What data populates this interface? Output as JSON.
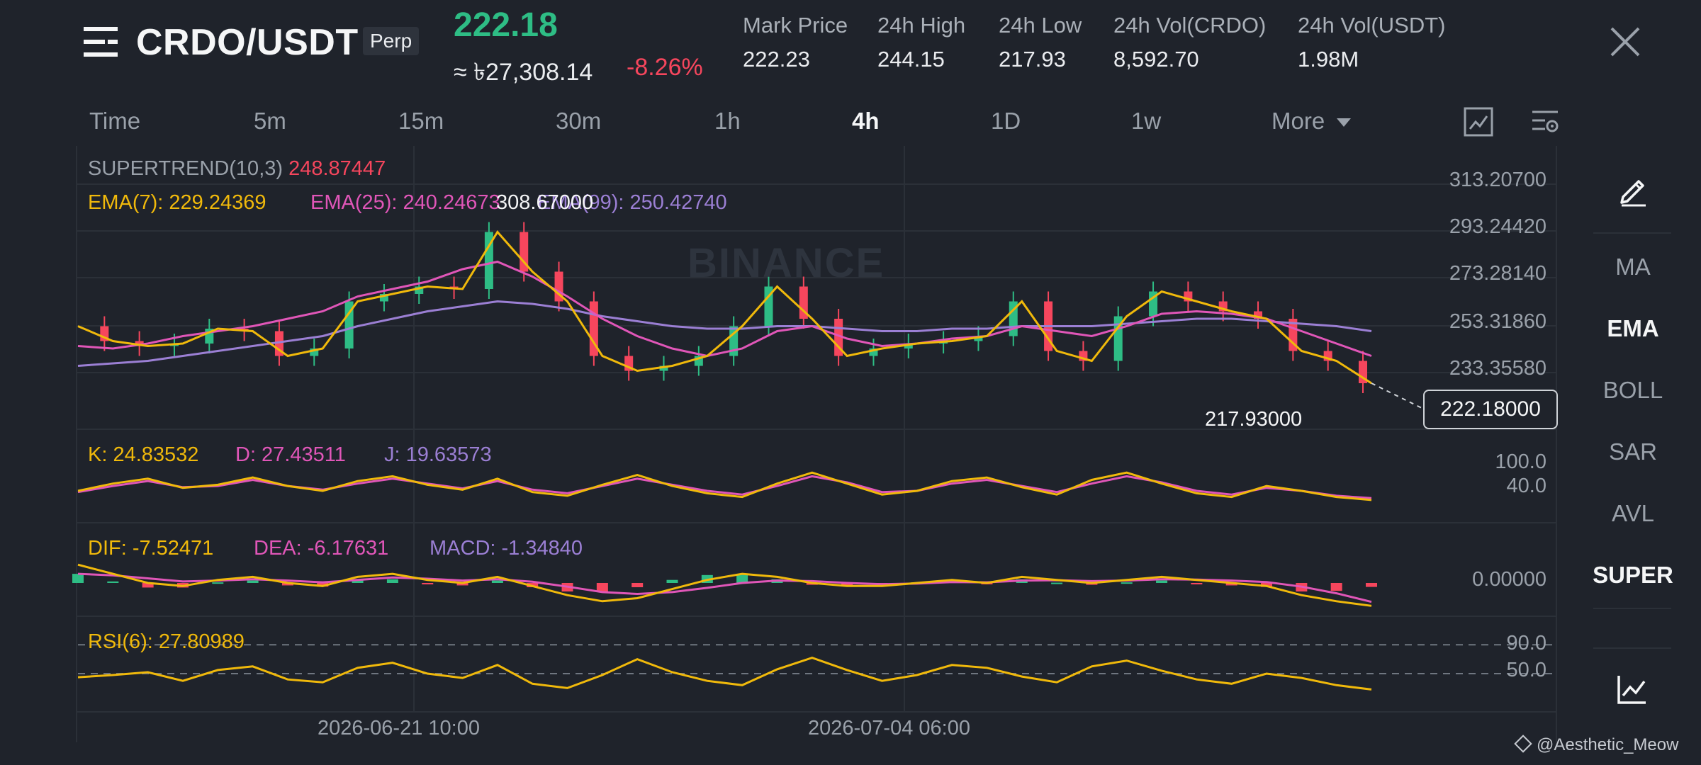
{
  "header": {
    "pair": "CRDO/USDT",
    "badge": "Perp",
    "last_price": "222.18",
    "approx_price": "≈ ৳27,308.14",
    "change": "-8.26%",
    "stats": [
      {
        "label": "Mark Price",
        "value": "222.23"
      },
      {
        "label": "24h High",
        "value": "244.15"
      },
      {
        "label": "24h Low",
        "value": "217.93"
      },
      {
        "label": "24h Vol(CRDO)",
        "value": "8,592.70"
      },
      {
        "label": "24h Vol(USDT)",
        "value": "1.98M"
      }
    ]
  },
  "timeframes": {
    "items": [
      "Time",
      "5m",
      "15m",
      "30m",
      "1h",
      "4h",
      "1D",
      "1w"
    ],
    "active": "4h",
    "more": "More"
  },
  "sidebar": {
    "items": [
      "MA",
      "EMA",
      "BOLL",
      "SAR",
      "AVL",
      "SUPER"
    ],
    "active": [
      "EMA",
      "SUPER"
    ]
  },
  "indicators": {
    "supertrend_label": "SUPERTREND(10,3)",
    "supertrend_value": "248.87447",
    "ema7": "EMA(7): 229.24369",
    "ema25": "EMA(25): 240.24673",
    "ema99": "EMA(99): 250.42740",
    "k": "K: 24.83532",
    "d": "D: 27.43511",
    "j": "J: 19.63573",
    "dif": "DIF: -7.52471",
    "dea": "DEA: -6.17631",
    "macd": "MACD: -1.34840",
    "rsi": "RSI(6): 27.80989"
  },
  "price_axis": [
    "313.20700",
    "293.24420",
    "273.28140",
    "253.31860",
    "233.35580"
  ],
  "kdj_axis": [
    "100.0",
    "40.0"
  ],
  "macd_axis": [
    "0.00000"
  ],
  "rsi_axis": [
    "90.0",
    "50.0"
  ],
  "annotations": {
    "high": "308.67000",
    "low": "217.93000",
    "current": "222.18000"
  },
  "time_axis": [
    "2026-06-21 10:00",
    "2026-07-04 06:00"
  ],
  "watermark": "BINANCE",
  "footer": "@Aesthetic_Meow",
  "colors": {
    "up": "#2ebd85",
    "down": "#f6465d",
    "ema7": "#f0b90b",
    "ema25": "#e056b8",
    "ema99": "#9b7fd4",
    "background": "#1f232b"
  },
  "chart_data": {
    "type": "line",
    "description_series": [
      {
        "name": "EMA(7)",
        "values": [
          252,
          246,
          244,
          245,
          251,
          250,
          240,
          243,
          262,
          265,
          268,
          267,
          290,
          274,
          262,
          240,
          234,
          236,
          240,
          252,
          268,
          255,
          240,
          243,
          245,
          246,
          248,
          262,
          242,
          238,
          256,
          266,
          262,
          258,
          255,
          242,
          238,
          229
        ]
      },
      {
        "name": "EMA(25)",
        "values": [
          244,
          243,
          245,
          248,
          250,
          252,
          255,
          258,
          264,
          267,
          270,
          275,
          278,
          272,
          264,
          255,
          248,
          243,
          240,
          243,
          250,
          252,
          247,
          244,
          245,
          247,
          248,
          252,
          250,
          248,
          252,
          257,
          258,
          257,
          255,
          250,
          245,
          240
        ]
      },
      {
        "name": "EMA(99)",
        "values": [
          236,
          237,
          238,
          240,
          242,
          244,
          246,
          248,
          252,
          255,
          258,
          260,
          262,
          261,
          259,
          256,
          254,
          252,
          251,
          251,
          252,
          252,
          251,
          250,
          250,
          251,
          251,
          252,
          252,
          252,
          253,
          254,
          255,
          255,
          254,
          253,
          252,
          250
        ]
      }
    ],
    "ylim": [
      215,
      315
    ],
    "kdj": {
      "k": [
        50,
        62,
        70,
        55,
        60,
        72,
        58,
        50,
        66,
        74,
        60,
        52,
        70,
        48,
        42,
        60,
        76,
        58,
        46,
        40,
        62,
        80,
        62,
        44,
        50,
        66,
        72,
        56,
        44,
        68,
        80,
        62,
        46,
        40,
        58,
        50,
        40,
        35
      ],
      "d": [
        48,
        58,
        66,
        56,
        58,
        68,
        58,
        52,
        62,
        70,
        62,
        54,
        66,
        52,
        46,
        58,
        70,
        60,
        50,
        44,
        58,
        74,
        64,
        48,
        50,
        62,
        68,
        58,
        48,
        62,
        74,
        64,
        50,
        44,
        55,
        50,
        42,
        38
      ],
      "ylim": [
        0,
        100
      ]
    },
    "macd": {
      "dif": [
        6,
        3,
        0,
        -1,
        1,
        2,
        0,
        -1,
        2,
        3,
        1,
        0,
        2,
        -1,
        -4,
        -6,
        -5,
        -2,
        1,
        3,
        2,
        0,
        -1,
        -1,
        0,
        1,
        0,
        2,
        1,
        0,
        1,
        2,
        1,
        0,
        -1,
        -4,
        -6,
        -7.5
      ],
      "dea": [
        3,
        2.5,
        1.5,
        0.5,
        0.8,
        1.2,
        0.8,
        0.2,
        1,
        1.8,
        1.4,
        0.8,
        1.2,
        0.4,
        -1.2,
        -3,
        -3.6,
        -3,
        -1.6,
        0,
        0.8,
        0.6,
        0,
        -0.4,
        -0.2,
        0.3,
        0.2,
        0.8,
        0.9,
        0.6,
        0.8,
        1.2,
        1.1,
        0.8,
        0.3,
        -1.2,
        -3.4,
        -6.2
      ],
      "ylim": [
        -10,
        10
      ]
    },
    "rsi": {
      "values": [
        45,
        48,
        52,
        40,
        55,
        60,
        42,
        38,
        58,
        65,
        50,
        44,
        62,
        36,
        30,
        48,
        70,
        52,
        40,
        34,
        56,
        72,
        55,
        40,
        48,
        62,
        58,
        46,
        38,
        60,
        68,
        54,
        42,
        36,
        50,
        44,
        34,
        28
      ],
      "ylim": [
        0,
        100
      ],
      "levels": [
        90,
        50
      ]
    }
  }
}
